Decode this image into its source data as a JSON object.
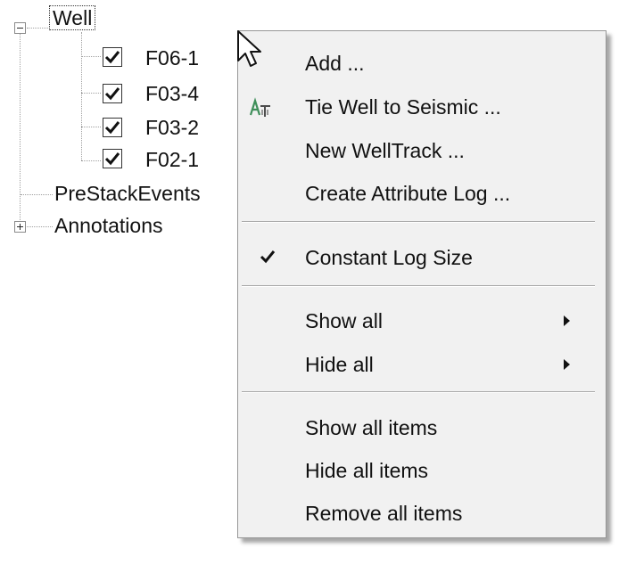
{
  "tree": {
    "well": {
      "label": "Well",
      "expanded": true,
      "children": [
        {
          "label": "F06-1",
          "checked": true
        },
        {
          "label": "F03-4",
          "checked": true
        },
        {
          "label": "F03-2",
          "checked": true
        },
        {
          "label": "F02-1",
          "checked": true
        }
      ]
    },
    "prestack": {
      "label": "PreStackEvents"
    },
    "annotations": {
      "label": "Annotations",
      "expanded": false
    }
  },
  "context_menu": {
    "items": [
      {
        "label": "Add ...",
        "icon": null
      },
      {
        "label": "Tie Well to Seismic ...",
        "icon": "tie-well-icon"
      },
      {
        "label": "New WellTrack ...",
        "icon": null
      },
      {
        "label": "Create Attribute Log ...",
        "icon": null
      },
      {
        "label": "Constant Log Size",
        "checked": true
      },
      {
        "label": "Show all",
        "submenu": true
      },
      {
        "label": "Hide all",
        "submenu": true
      },
      {
        "label": "Show all items"
      },
      {
        "label": "Hide all items"
      },
      {
        "label": "Remove all items"
      }
    ]
  },
  "colors": {
    "menu_bg": "#f1f1f1",
    "menu_border": "#979797",
    "separator": "#a8a8a8",
    "text": "#111111",
    "tie_icon_green": "#3f8f5a"
  }
}
